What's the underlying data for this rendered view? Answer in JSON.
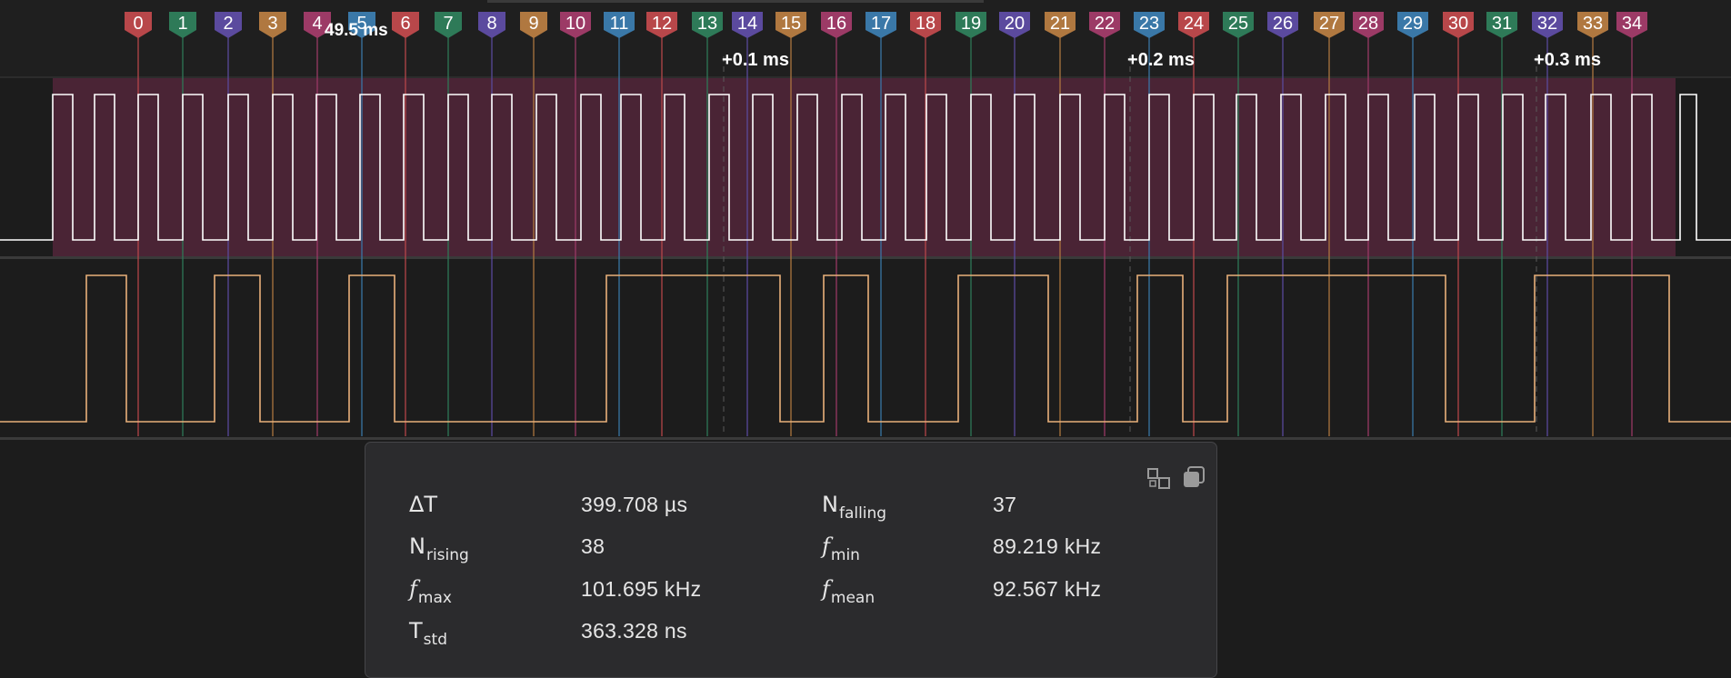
{
  "time_cursor_label": "49.5 ms",
  "time_ticks": [
    "+0.1 ms",
    "+0.2 ms",
    "+0.3 ms"
  ],
  "markers": [
    {
      "label": "0",
      "color": "#b8474a"
    },
    {
      "label": "1",
      "color": "#2e7a58"
    },
    {
      "label": "2",
      "color": "#5b4a9e"
    },
    {
      "label": "3",
      "color": "#b07840"
    },
    {
      "label": "4",
      "color": "#9c3a66"
    },
    {
      "label": "5",
      "color": "#3a78a8"
    },
    {
      "label": "6",
      "color": "#b8474a"
    },
    {
      "label": "7",
      "color": "#2e7a58"
    },
    {
      "label": "8",
      "color": "#5b4a9e"
    },
    {
      "label": "9",
      "color": "#b07840"
    },
    {
      "label": "10",
      "color": "#9c3a66"
    },
    {
      "label": "11",
      "color": "#3a78a8"
    },
    {
      "label": "12",
      "color": "#b8474a"
    },
    {
      "label": "13",
      "color": "#2e7a58"
    },
    {
      "label": "14",
      "color": "#5b4a9e"
    },
    {
      "label": "15",
      "color": "#b07840"
    },
    {
      "label": "16",
      "color": "#9c3a66"
    },
    {
      "label": "17",
      "color": "#3a78a8"
    },
    {
      "label": "18",
      "color": "#b8474a"
    },
    {
      "label": "19",
      "color": "#2e7a58"
    },
    {
      "label": "20",
      "color": "#5b4a9e"
    },
    {
      "label": "21",
      "color": "#b07840"
    },
    {
      "label": "22",
      "color": "#9c3a66"
    },
    {
      "label": "23",
      "color": "#3a78a8"
    },
    {
      "label": "24",
      "color": "#b8474a"
    },
    {
      "label": "25",
      "color": "#2e7a58"
    },
    {
      "label": "26",
      "color": "#5b4a9e"
    },
    {
      "label": "27",
      "color": "#b07840"
    },
    {
      "label": "28",
      "color": "#9c3a66"
    },
    {
      "label": "29",
      "color": "#3a78a8"
    },
    {
      "label": "30",
      "color": "#b8474a"
    },
    {
      "label": "31",
      "color": "#2e7a58"
    },
    {
      "label": "32",
      "color": "#5b4a9e"
    },
    {
      "label": "33",
      "color": "#b07840"
    },
    {
      "label": "34",
      "color": "#9c3a66"
    }
  ],
  "colors": {
    "background": "#1c1c1c",
    "channel_selection": "#4a2435",
    "channel0_trace": "#ffffff",
    "channel1_trace": "#e8b07a",
    "separator": "#3c3c3c"
  },
  "measurements": {
    "delta_t": {
      "symbol": "ΔT",
      "value": "399.708 µs"
    },
    "n_falling": {
      "symbol": "N",
      "sub": "falling",
      "value": "37"
    },
    "n_rising": {
      "symbol": "N",
      "sub": "rising",
      "value": "38"
    },
    "f_min": {
      "symbol": "f",
      "sub": "min",
      "value": "89.219 kHz"
    },
    "f_max": {
      "symbol": "f",
      "sub": "max",
      "value": "101.695 kHz"
    },
    "f_mean": {
      "symbol": "f",
      "sub": "mean",
      "value": "92.567 kHz"
    },
    "t_std": {
      "symbol": "T",
      "sub": "std",
      "value": "363.328 ns"
    }
  },
  "panel_icons": [
    "layout-icon",
    "copy-icon"
  ]
}
